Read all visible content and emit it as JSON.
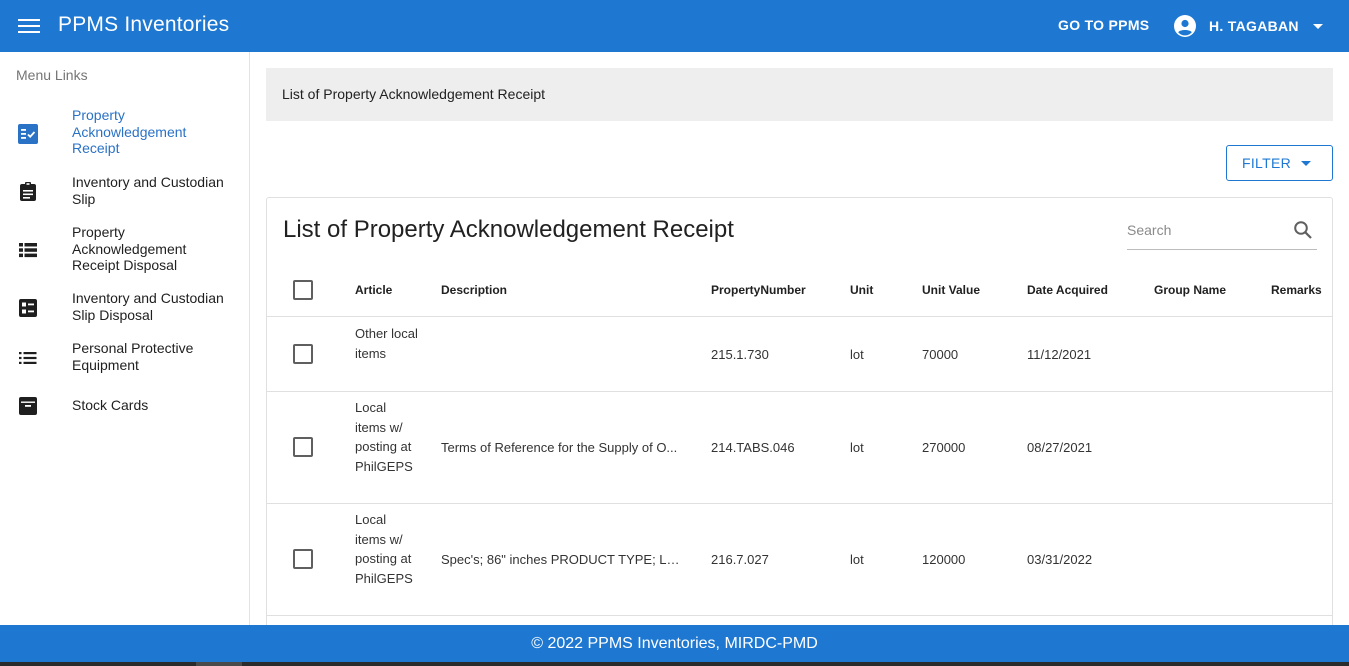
{
  "app": {
    "title": "PPMS Inventories",
    "go_to_label": "GO TO PPMS",
    "user_name": "H. TAGABAN"
  },
  "sidebar": {
    "header": "Menu Links",
    "items": [
      {
        "label": "Property Acknowledgement Receipt",
        "icon": "checklist-icon",
        "active": true
      },
      {
        "label": "Inventory and Custodian Slip",
        "icon": "clipboard-icon",
        "active": false
      },
      {
        "label": "Property Acknowledgement Receipt Disposal",
        "icon": "view-list-icon",
        "active": false
      },
      {
        "label": "Inventory and Custodian Slip Disposal",
        "icon": "list-alt-icon",
        "active": false
      },
      {
        "label": "Personal Protective Equipment",
        "icon": "list-icon",
        "active": false
      },
      {
        "label": "Stock Cards",
        "icon": "archive-icon",
        "active": false
      }
    ]
  },
  "breadcrumb": "List of Property Acknowledgement Receipt",
  "filter_label": "FILTER",
  "card": {
    "title": "List of Property Acknowledgement Receipt",
    "search_placeholder": "Search"
  },
  "table": {
    "columns": [
      "Article",
      "Description",
      "PropertyNumber",
      "Unit",
      "Unit Value",
      "Date Acquired",
      "Group Name",
      "Remarks"
    ],
    "rows": [
      {
        "article": "Other local items",
        "description": "",
        "property_number": "215.1.730",
        "unit": "lot",
        "unit_value": "70000",
        "date_acquired": "11/12/2021",
        "group_name": "",
        "remarks": ""
      },
      {
        "article": "Local items w/ posting at PhilGEPS",
        "description": "Terms of Reference for the Supply of O...",
        "property_number": "214.TABS.046",
        "unit": "lot",
        "unit_value": "270000",
        "date_acquired": "08/27/2021",
        "group_name": "",
        "remarks": ""
      },
      {
        "article": "Local items w/ posting at PhilGEPS",
        "description": "Spec's; 86\" inches PRODUCT TYPE; LED,...",
        "property_number": "216.7.027",
        "unit": "lot",
        "unit_value": "120000",
        "date_acquired": "03/31/2022",
        "group_name": "",
        "remarks": ""
      }
    ]
  },
  "footer": "© 2022 PPMS Inventories, MIRDC-PMD",
  "colors": {
    "primary": "#1e78d2",
    "active_link": "#2a72c6",
    "breadcrumb_bg": "#eeeeee"
  }
}
